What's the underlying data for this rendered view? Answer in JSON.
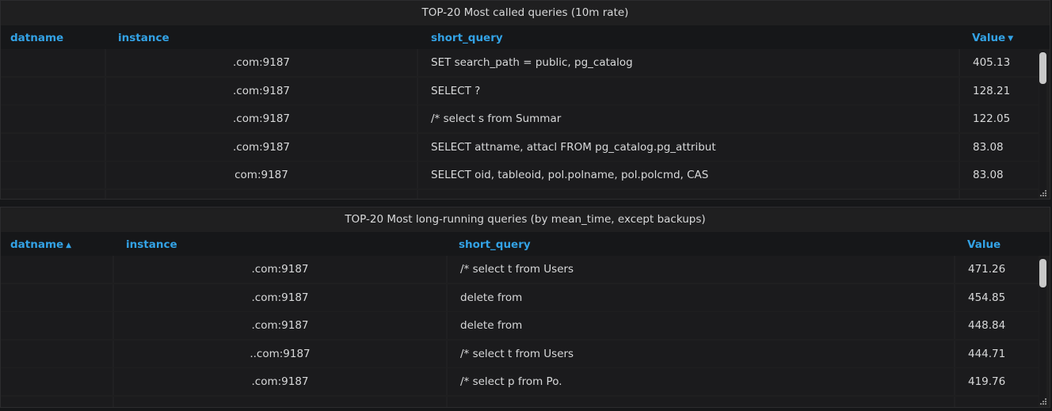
{
  "panel1": {
    "title": "TOP-20 Most called queries (10m rate)",
    "columns": [
      "datname",
      "instance",
      "short_query",
      "Value"
    ],
    "sort_indicator": "▼",
    "rows": [
      {
        "datname": "",
        "instance": ".com:9187",
        "short_query": "SET search_path = public, pg_catalog",
        "value": "405.13"
      },
      {
        "datname": "",
        "instance": ".com:9187",
        "short_query": "SELECT ?",
        "value": "128.21"
      },
      {
        "datname": "",
        "instance": ".com:9187",
        "short_query": "/* select s from Summar",
        "value": "122.05"
      },
      {
        "datname": "",
        "instance": ".com:9187",
        "short_query": "SELECT attname, attacl FROM pg_catalog.pg_attribut",
        "value": "83.08"
      },
      {
        "datname": "",
        "instance": "com:9187",
        "short_query": "SELECT oid, tableoid, pol.polname, pol.polcmd, CAS",
        "value": "83.08"
      }
    ]
  },
  "panel2": {
    "title": "TOP-20 Most long-running queries (by mean_time, except backups)",
    "columns": [
      "datname",
      "instance",
      "short_query",
      "Value"
    ],
    "sort_indicator": "▲",
    "rows": [
      {
        "datname": "",
        "instance": ".com:9187",
        "short_query": "/* select t from Users",
        "value": "471.26"
      },
      {
        "datname": "",
        "instance": ".com:9187",
        "short_query": "delete from",
        "value": "454.85"
      },
      {
        "datname": "",
        "instance": ".com:9187",
        "short_query": "delete from",
        "value": "448.84"
      },
      {
        "datname": "",
        "instance": "..com:9187",
        "short_query": "/* select t from Users",
        "value": "444.71"
      },
      {
        "datname": "",
        "instance": ".com:9187",
        "short_query": "/* select p from Po.",
        "value": "419.76"
      }
    ]
  },
  "colors": {
    "header_link": "#33a2e5",
    "background": "#161719",
    "panel": "#1f1f20"
  },
  "icons": [
    "sort-desc-icon",
    "sort-asc-icon",
    "resize-handle-icon"
  ]
}
